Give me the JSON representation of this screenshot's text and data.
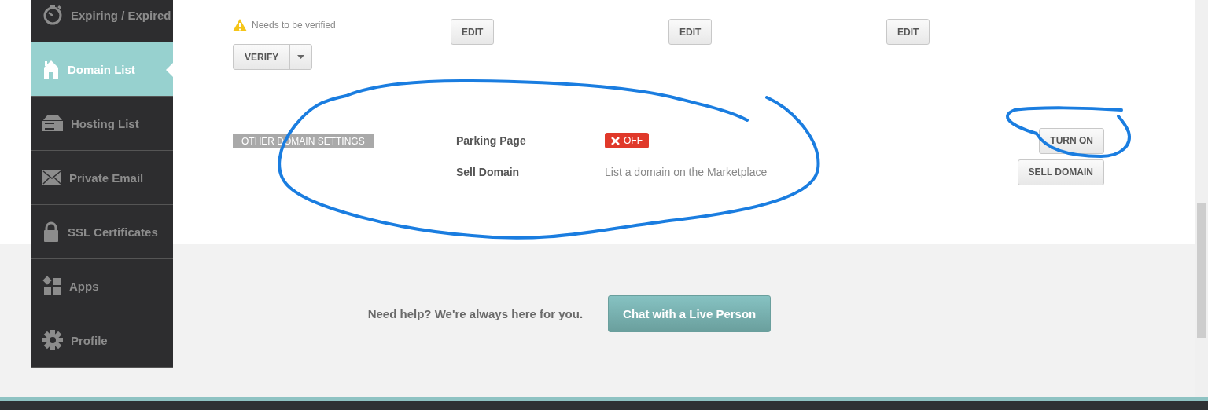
{
  "sidebar": {
    "items": [
      {
        "label": "Expiring / Expired",
        "selected": false
      },
      {
        "label": "Domain List",
        "selected": true
      },
      {
        "label": "Hosting List",
        "selected": false
      },
      {
        "label": "Private Email",
        "selected": false
      },
      {
        "label": "SSL Certificates",
        "selected": false
      },
      {
        "label": "Apps",
        "selected": false
      },
      {
        "label": "Profile",
        "selected": false
      }
    ]
  },
  "verification": {
    "notice": "Needs to be verified",
    "button": "VERIFY"
  },
  "edit_buttons": [
    "EDIT",
    "EDIT",
    "EDIT"
  ],
  "other_settings": {
    "tag": "OTHER DOMAIN SETTINGS",
    "rows": [
      {
        "kind": "status",
        "label": "Parking Page",
        "status": {
          "text": "OFF",
          "on": false
        },
        "button": "TURN ON"
      },
      {
        "kind": "text",
        "label": "Sell Domain",
        "description": "List a domain on the Marketplace",
        "button": "SELL DOMAIN"
      }
    ]
  },
  "help": {
    "text": "Need help? We're always here for you.",
    "button": "Chat with a Live Person"
  }
}
